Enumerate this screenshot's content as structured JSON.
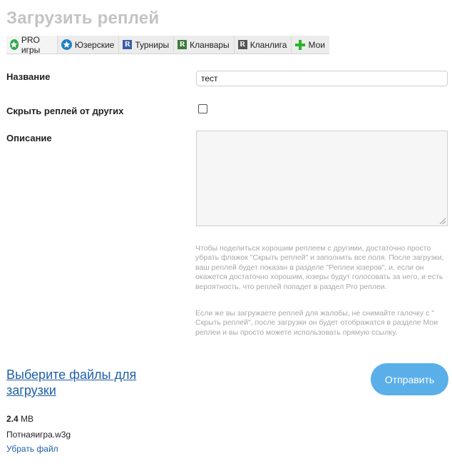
{
  "page": {
    "title": "Загрузить реплей"
  },
  "tabs": [
    {
      "label": "PRO игры",
      "icon": "star-icon"
    },
    {
      "label": "Юзерские",
      "icon": "star-icon"
    },
    {
      "label": "Турниры",
      "icon": "r-icon"
    },
    {
      "label": "Кланвары",
      "icon": "r-icon"
    },
    {
      "label": "Кланлига",
      "icon": "r-icon"
    },
    {
      "label": "Мои",
      "icon": "plus-icon"
    }
  ],
  "form": {
    "name_label": "Название",
    "name_value": "тест",
    "hide_label": "Скрыть реплей от других",
    "hide_checked": false,
    "description_label": "Описание",
    "description_value": "",
    "hint_1": "Чтобы поделиться хорошим реплеем с другими, достаточно просто убрать флажок \"Скрыть реплей\" и заполнить все поля. После загрузки, ваш реплей будет показан в разделе \"Реплеи юзеров\", и, если он окажется достаточно хорошим, юзеры будут голосовать за него, и есть вероятность, что реплей попадет в раздел Pro реплеи.",
    "hint_2": "Если же вы загружаете реплей для жалобы, не снимайте галочку с \" Скрыть реплей\", после загрузки он будет отображатся в разделе Мои реплеи и вы просто можете использовать прямую ссылку."
  },
  "upload": {
    "choose_label": "Выберите файлы для загрузки",
    "submit_label": "Отправить",
    "file_size": "2.4",
    "file_size_unit": "MB",
    "file_name": "Потнаяигра.w3g",
    "remove_label": "Убрать файл"
  },
  "colors": {
    "title": "#c3c3c3",
    "link": "#1f5fa8",
    "button": "#5aafe9",
    "star_green": "#2fa84a",
    "star_blue": "#1f7fc4",
    "r_blue": "#3b5ea8",
    "r_green": "#3c7a3a",
    "r_gray": "#555555",
    "plus_green": "#2cb52c"
  }
}
